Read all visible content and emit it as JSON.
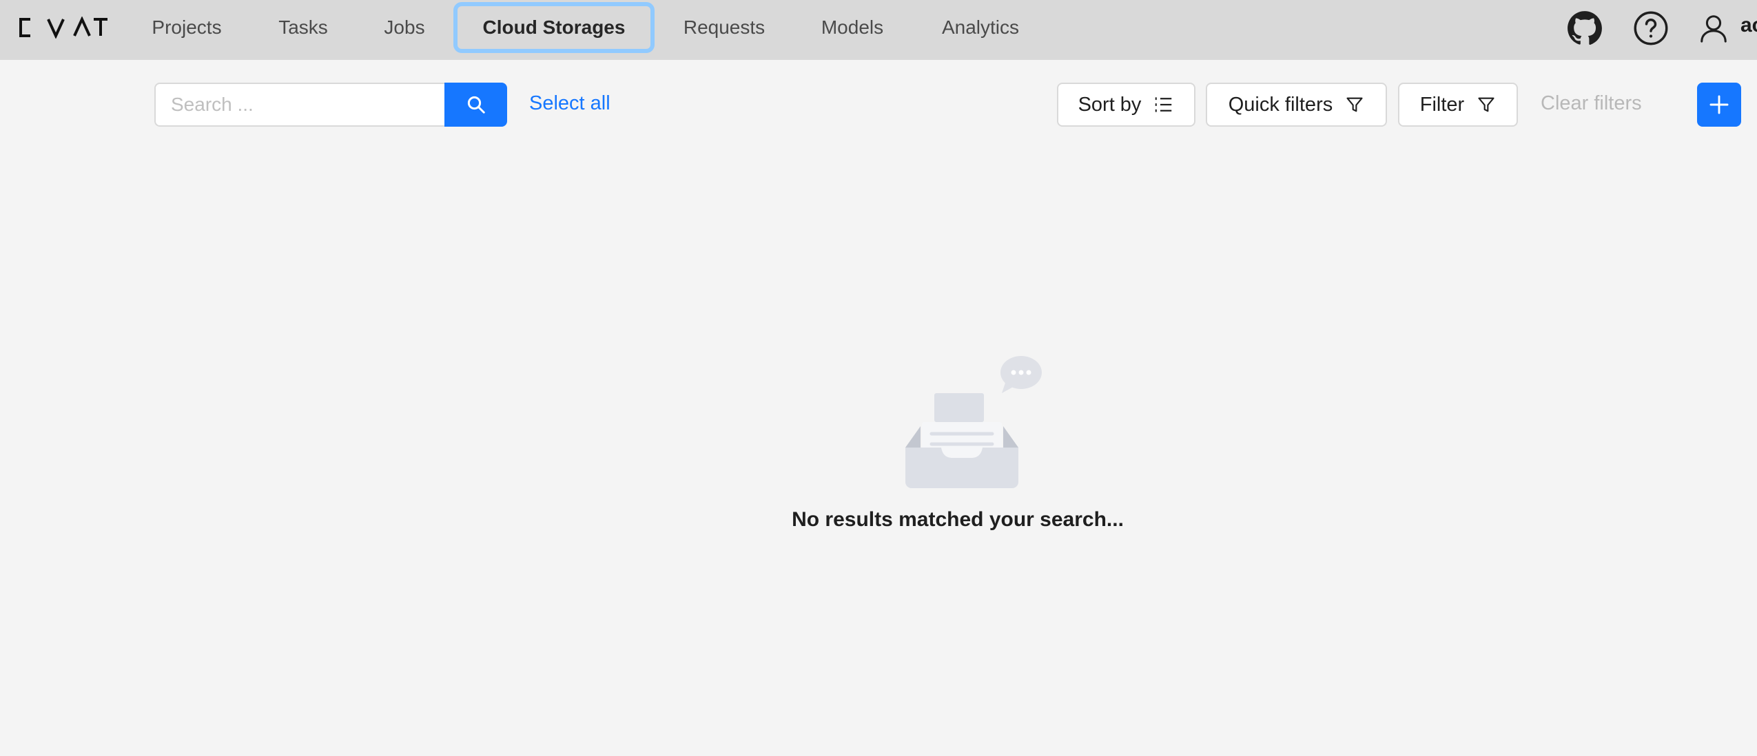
{
  "app": {
    "logo_text": "CVAT"
  },
  "nav": {
    "items": [
      {
        "label": "Projects",
        "active": false
      },
      {
        "label": "Tasks",
        "active": false
      },
      {
        "label": "Jobs",
        "active": false
      },
      {
        "label": "Cloud Storages",
        "active": true
      },
      {
        "label": "Requests",
        "active": false
      },
      {
        "label": "Models",
        "active": false
      },
      {
        "label": "Analytics",
        "active": false
      }
    ]
  },
  "header_right": {
    "icons": [
      "github-icon",
      "help-icon",
      "user-icon"
    ],
    "user_label": "ac"
  },
  "toolbar": {
    "search_placeholder": "Search ...",
    "search_value": "",
    "select_all_label": "Select all",
    "sort_label": "Sort by",
    "quick_filters_label": "Quick filters",
    "filter_label": "Filter",
    "clear_filters_label": "Clear filters"
  },
  "empty_state": {
    "message": "No results matched your search..."
  },
  "colors": {
    "primary": "#1677ff",
    "header_bg": "#d9d9d9",
    "page_bg": "#f4f4f4",
    "active_tab_border": "#91caff",
    "disabled_text": "#b8b8b8"
  }
}
